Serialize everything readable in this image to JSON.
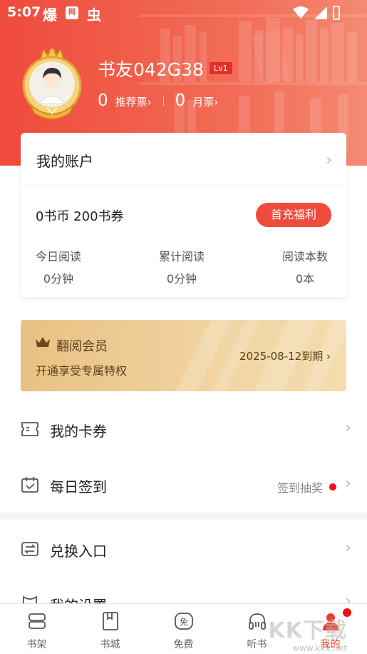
{
  "status_bar": {
    "time": "5:07",
    "icon1": "爆",
    "icon2": "网",
    "icon3": "虫"
  },
  "profile": {
    "username": "书友042G38",
    "level": "Lv1",
    "recommend_count": "0",
    "recommend_label": "推荐票›",
    "monthly_count": "0",
    "monthly_label": "月票›"
  },
  "account": {
    "title": "我的账户",
    "arrow": "›",
    "coins": "0书币  200书券",
    "charge_button": "首充福利",
    "stats": [
      {
        "label": "今日阅读",
        "value": "0分钟"
      },
      {
        "label": "累计阅读",
        "value": "0分钟"
      },
      {
        "label": "阅读本数",
        "value": "0本"
      }
    ]
  },
  "vip": {
    "title": "翻阅会员",
    "subtitle": "开通享受专属特权",
    "expiry": "2025-08-12到期 ›"
  },
  "menu": [
    {
      "label": "我的卡券",
      "icon": "ticket-icon"
    },
    {
      "label": "每日签到",
      "icon": "calendar-icon",
      "hint": "签到抽奖"
    },
    {
      "label": "兑换入口",
      "icon": "exchange-icon"
    },
    {
      "label": "我的设置",
      "icon": "settings-icon"
    }
  ],
  "tabs": [
    {
      "label": "书架",
      "icon": "bookshelf-icon"
    },
    {
      "label": "书城",
      "icon": "bookstore-icon"
    },
    {
      "label": "免费",
      "icon": "free-icon",
      "glyph": "免"
    },
    {
      "label": "听书",
      "icon": "headphones-icon"
    },
    {
      "label": "我的",
      "icon": "profile-icon"
    }
  ],
  "watermark": {
    "text": "KK下载",
    "url_text": "www.kkx.net"
  },
  "colors": {
    "accent": "#ee4b3d",
    "vip_gold": "#e8c183"
  }
}
